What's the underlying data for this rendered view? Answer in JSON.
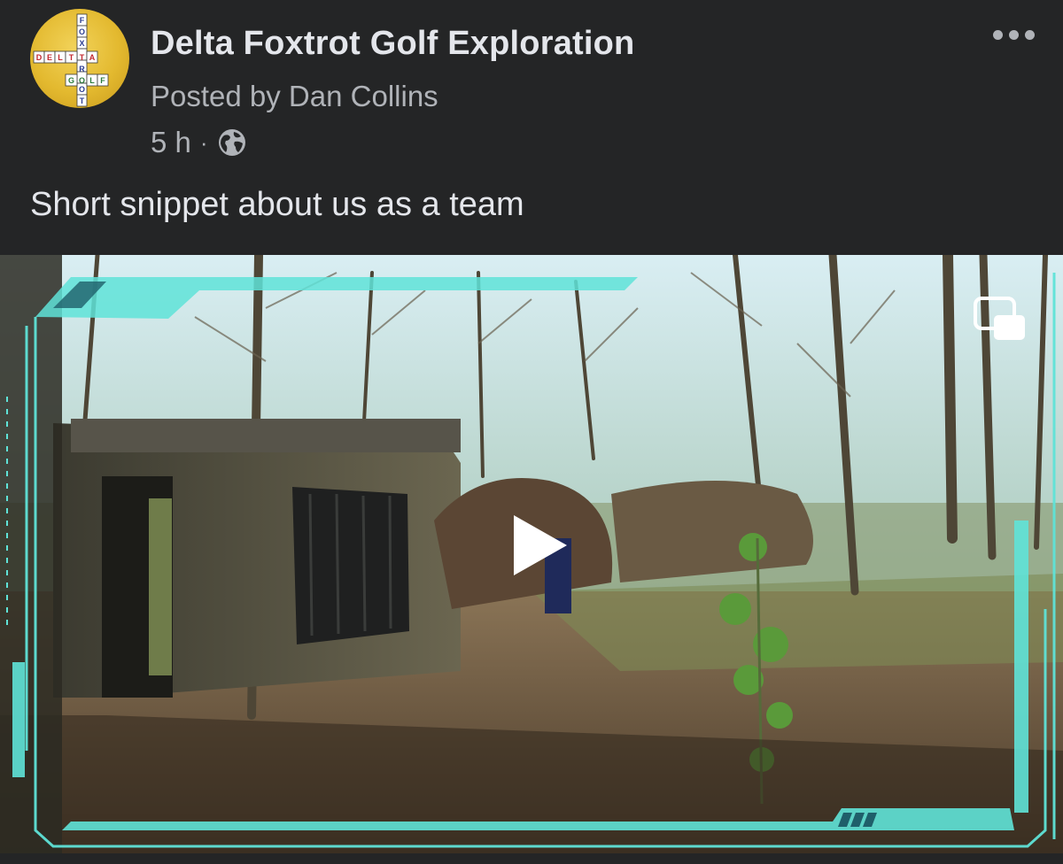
{
  "post": {
    "page_name": "Delta Foxtrot Golf Exploration",
    "posted_by": "Posted by Dan Collins",
    "time": "5 h",
    "separator": "·",
    "audience_icon": "globe-icon",
    "text": "Short snippet about us as a team",
    "more_icon": "more-dots-icon"
  },
  "avatar": {
    "word_across_top": "DELTA",
    "word_down": "FOXTROT",
    "word_across_bottom": "GOLF",
    "background_color": "#e3b92f"
  },
  "video": {
    "play_icon": "play-icon",
    "pip_icon": "picture-in-picture-icon",
    "frame_accent_color": "#5fe3d8"
  },
  "theme": {
    "background": "#242526",
    "primary_text": "#e4e6eb",
    "secondary_text": "#b0b3b8"
  }
}
